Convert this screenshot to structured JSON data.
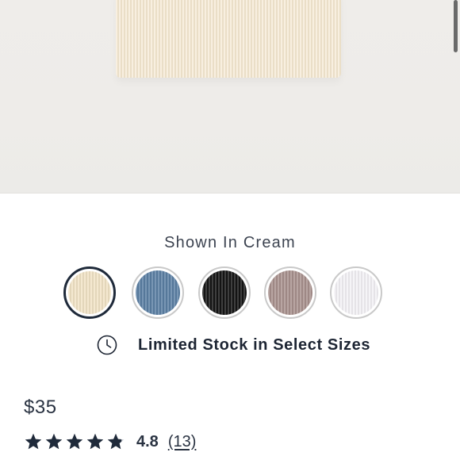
{
  "product": {
    "image_alt": "cream ribbed top",
    "color_caption": "Shown In Cream",
    "swatches": [
      {
        "name": "Cream",
        "color": "#f1e3c6",
        "selected": true
      },
      {
        "name": "Blue",
        "color": "#5b7fa4",
        "selected": false
      },
      {
        "name": "Black",
        "color": "#151515",
        "selected": false
      },
      {
        "name": "Mauve",
        "color": "#a8918d",
        "selected": false
      },
      {
        "name": "White",
        "color": "#f3f1f5",
        "selected": false
      }
    ],
    "stock_message": "Limited Stock in Select Sizes",
    "price": "$35",
    "rating": {
      "stars": 4.8,
      "value": "4.8",
      "reviews": "(13)"
    }
  },
  "colors": {
    "text_dark": "#1d2533",
    "star": "#1f2a3a",
    "selected_ring": "#1f2a3a"
  },
  "icons": {
    "stock": "clock-icon",
    "rating": "star-icon"
  }
}
